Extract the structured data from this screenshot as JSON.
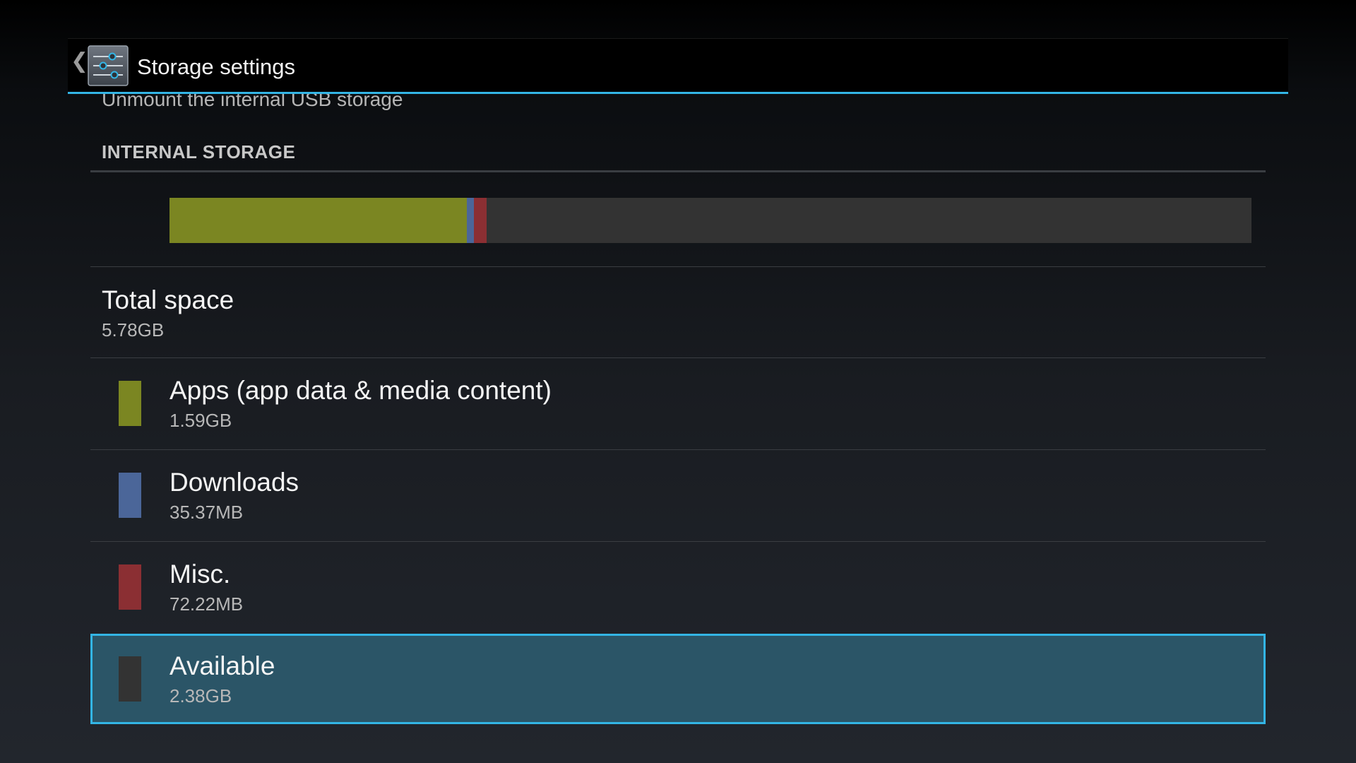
{
  "actionbar": {
    "title": "Storage settings",
    "icon": "settings-sliders-icon",
    "up_icon": "chevron-left-icon",
    "accent_color": "#33b5e5"
  },
  "clipped_summary": "Unmount the internal USB storage",
  "section": {
    "header": "INTERNAL STORAGE"
  },
  "usage_bar": {
    "total_gb": 5.78,
    "segments": [
      {
        "name": "Apps",
        "fraction": 0.2751,
        "color": "#7b8622"
      },
      {
        "name": "Downloads",
        "fraction": 0.006,
        "color": "#4b6699"
      },
      {
        "name": "Misc.",
        "fraction": 0.0122,
        "color": "#8b2f33"
      }
    ],
    "free_color": "#333333"
  },
  "total": {
    "label": "Total space",
    "value": "5.78GB"
  },
  "items": [
    {
      "label": "Apps (app data & media content)",
      "value": "1.59GB",
      "color": "#7b8622"
    },
    {
      "label": "Downloads",
      "value": "35.37MB",
      "color": "#4b6699"
    },
    {
      "label": "Misc.",
      "value": "72.22MB",
      "color": "#8b2f33"
    },
    {
      "label": "Available",
      "value": "2.38GB",
      "color": "#333333",
      "selected": true
    }
  ]
}
